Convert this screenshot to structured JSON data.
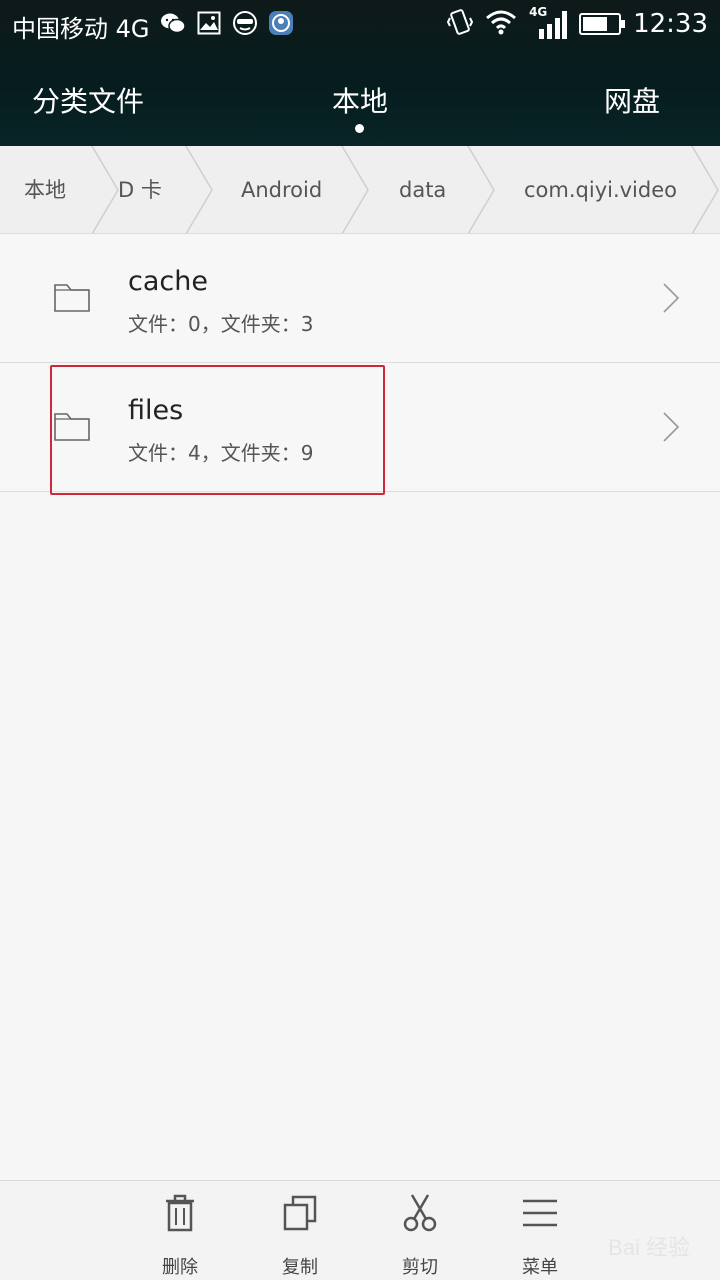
{
  "status_bar": {
    "carrier": "中国移动 4G",
    "network_label": "4G",
    "time": "12:33",
    "battery_percent": 70
  },
  "tabs": [
    {
      "label": "分类文件"
    },
    {
      "label": "本地",
      "active": true
    },
    {
      "label": "网盘"
    }
  ],
  "breadcrumb": [
    {
      "label": "本地"
    },
    {
      "label": "D 卡"
    },
    {
      "label": "Android"
    },
    {
      "label": "data"
    },
    {
      "label": "com.qiyi.video"
    }
  ],
  "list": [
    {
      "name": "cache",
      "meta": "文件：0，文件夹：3"
    },
    {
      "name": "files",
      "meta": "文件：4，文件夹：9"
    }
  ],
  "toolbar": {
    "delete_label": "删除",
    "copy_label": "复制",
    "cut_label": "剪切",
    "menu_label": "菜单"
  },
  "watermark": "Bai 经验",
  "colors": {
    "header_bg": "#061c1e",
    "highlight": "#d0273a",
    "list_bg": "#f7f7f7"
  }
}
